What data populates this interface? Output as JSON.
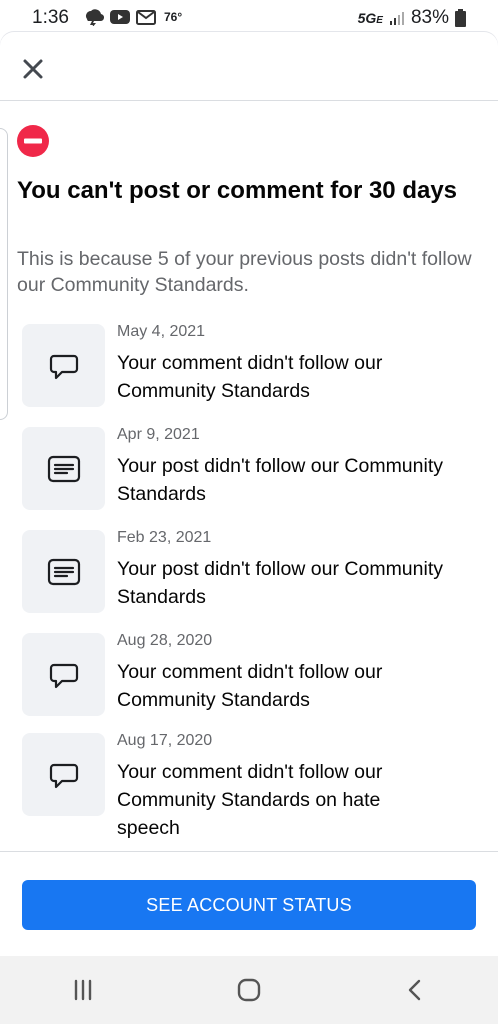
{
  "status_bar": {
    "time": "1:36",
    "temperature": "76°",
    "network": "5G",
    "network_sub": "E",
    "battery": "83%",
    "icons": [
      "weather-icon",
      "youtube-icon",
      "email-icon",
      "signal-icon",
      "battery-icon"
    ]
  },
  "dialog": {
    "close_icon": "close-icon",
    "warning_icon": "restricted-icon",
    "title": "You can't post or comment for 30 days",
    "subtitle": "This is because 5 of your previous posts didn't follow our Community Standards.",
    "violations": [
      {
        "date": "May 4, 2021",
        "text": "Your comment didn't follow our Community Standards",
        "icon": "comment-icon"
      },
      {
        "date": "Apr 9, 2021",
        "text": "Your post didn't follow our Community Standards",
        "icon": "post-icon"
      },
      {
        "date": "Feb 23, 2021",
        "text": "Your post didn't follow our Community Standards",
        "icon": "post-icon"
      },
      {
        "date": "Aug 28, 2020",
        "text": "Your comment didn't follow our Community Standards",
        "icon": "comment-icon"
      },
      {
        "date": "Aug 17, 2020",
        "text": "Your comment didn't follow our Community Standards on hate speech",
        "icon": "comment-icon"
      }
    ],
    "cta_label": "SEE ACCOUNT STATUS"
  },
  "colors": {
    "accent": "#1877f2",
    "warning": "#f02849",
    "icon_box": "#f0f2f5",
    "secondary_text": "#65676b"
  },
  "nav_bar": {
    "buttons": [
      "recent-apps-icon",
      "home-icon",
      "back-icon"
    ]
  }
}
